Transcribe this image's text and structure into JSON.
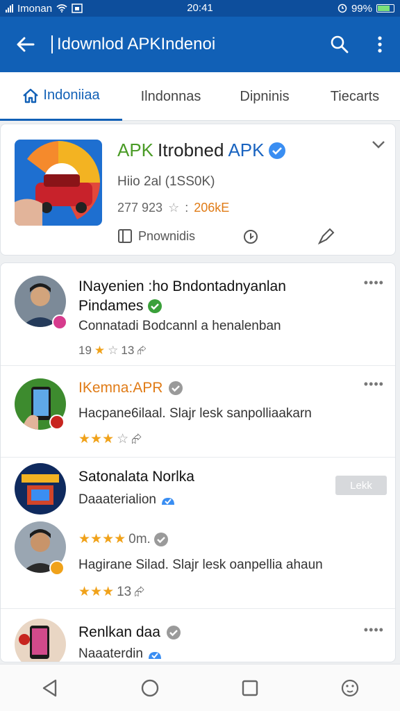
{
  "status_bar": {
    "carrier": "Imonan",
    "time": "20:41",
    "battery": "99%"
  },
  "app_bar": {
    "title": "Idownlod APKIndenoi"
  },
  "tabs": [
    {
      "label": "Indoniiaa",
      "active": true
    },
    {
      "label": "Ilndonnas",
      "active": false
    },
    {
      "label": "Dipninis",
      "active": false
    },
    {
      "label": "Tiecarts",
      "active": false
    }
  ],
  "hero": {
    "title_green": "APK",
    "title_dark": "Itrobned",
    "title_blue": "APK",
    "subtitle": "Hiio 2al (1SS0K)",
    "rating_count": "277 923",
    "size": "206kE",
    "action_label": "Pnownidis"
  },
  "feed": [
    {
      "title_line1": "INayenien :ho Bndontadnyanlan",
      "title_line2": "Pindames",
      "line2": "Connatadi Bodcannl a henalenban",
      "meta_text": "19",
      "meta_count": "13"
    },
    {
      "title": "IKemna:APR",
      "line2": "Hacpane6ilaal. Slajr lesk sanpolliaakarn",
      "meta_stars": 3
    },
    {
      "title": "Satonalata Norlka",
      "subtitle": "Daaaterialion",
      "follow_label": "Lekk"
    },
    {
      "meta_text": "0m.",
      "line2": "Hagirane Silad. Slajr lesk oanpellia ahaun",
      "meta_count": "13"
    },
    {
      "title": "Renlkan daa",
      "subtitle": "Naaaterdin"
    }
  ],
  "colors": {
    "primary": "#1160b6",
    "accent_green": "#4a9b26",
    "star": "#f0a21a",
    "orange": "#e07b16"
  },
  "icons": [
    "back-arrow-icon",
    "search-icon",
    "more-vert-icon",
    "home-icon",
    "star-icon",
    "verified-icon",
    "share-icon"
  ]
}
